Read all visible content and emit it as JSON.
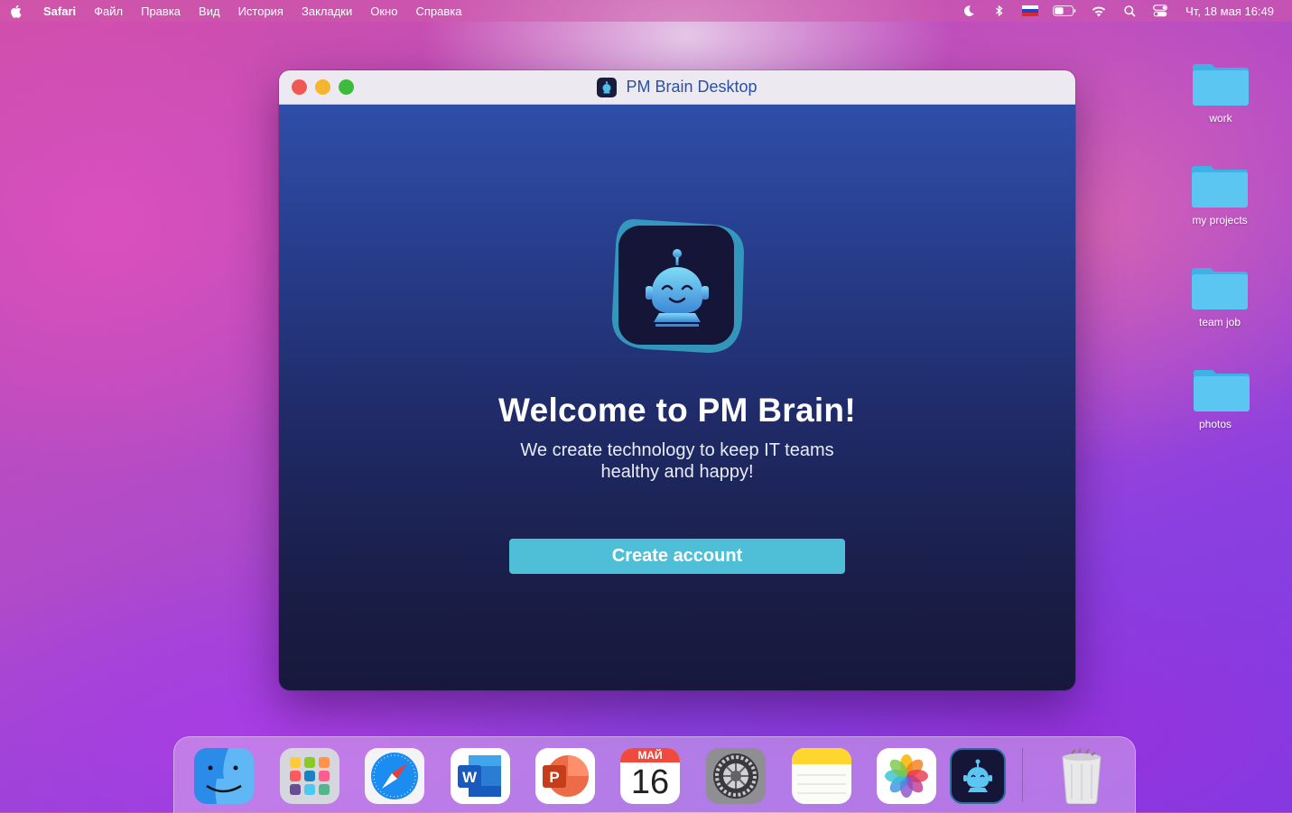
{
  "menubar": {
    "app_name": "Safari",
    "items": [
      "Файл",
      "Правка",
      "Вид",
      "История",
      "Закладки",
      "Окно",
      "Справка"
    ],
    "clock": "Чт, 18 мая  16:49",
    "battery_level": 0.5
  },
  "desktop": {
    "folders": [
      {
        "label": "work"
      },
      {
        "label": "my projects"
      },
      {
        "label": "team job"
      },
      {
        "label": "photos"
      }
    ]
  },
  "window": {
    "title": "PM Brain Desktop",
    "heading": "Welcome to PM Brain!",
    "subtitle_line1": "We create technology to keep IT teams",
    "subtitle_line2": "healthy and happy!",
    "cta_label": "Create account"
  },
  "dock": {
    "calendar_month": "МАЙ",
    "calendar_day": "16"
  },
  "colors": {
    "accent": "#4ebfd6",
    "title_text": "#2a4fa8",
    "folder": "#5cc6f2"
  }
}
